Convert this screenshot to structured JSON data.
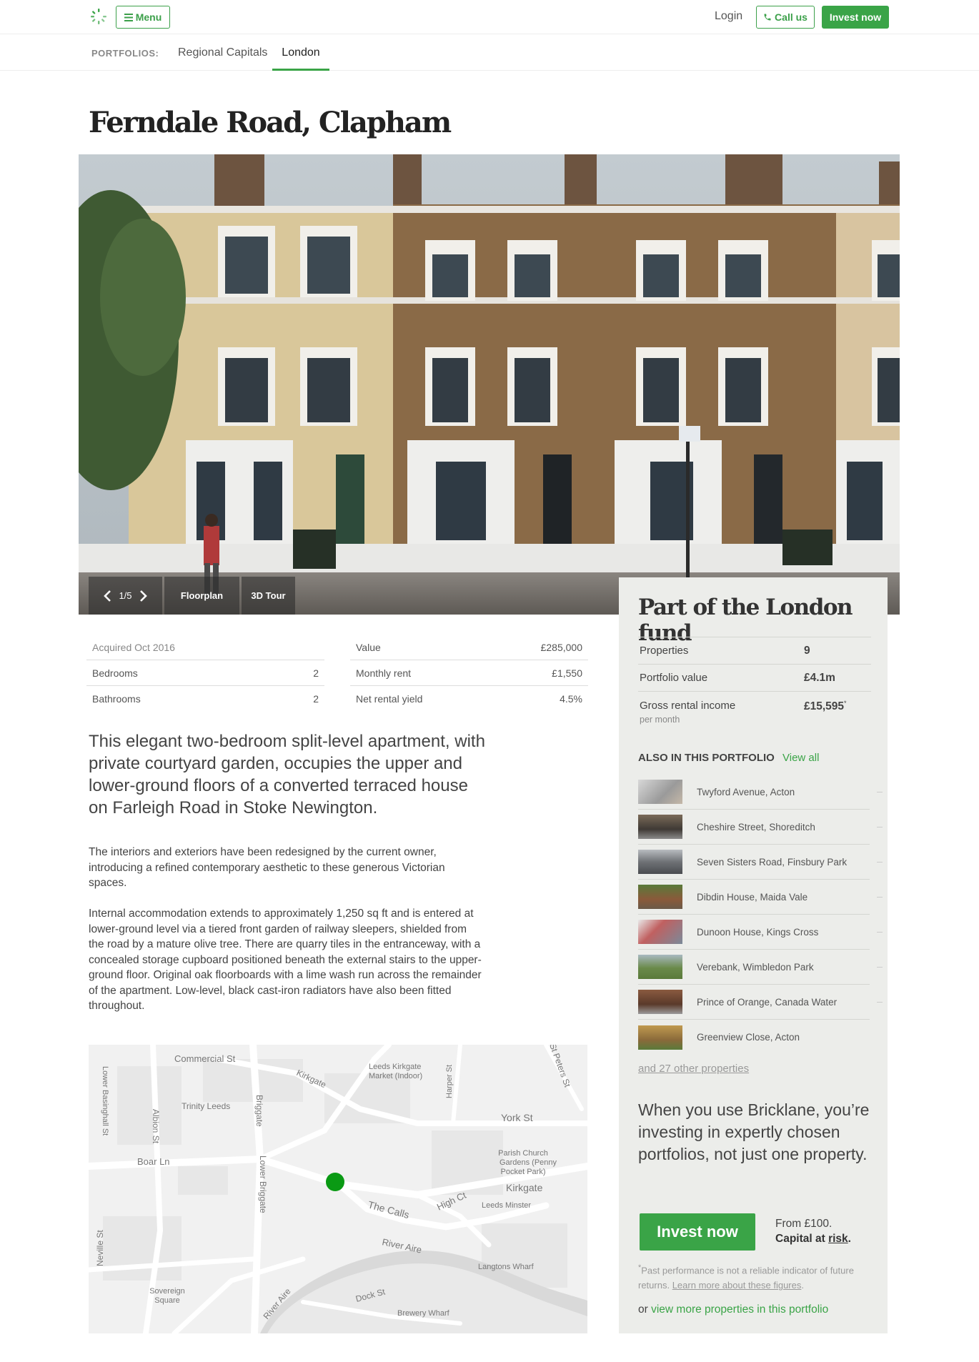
{
  "header": {
    "menu_label": "Menu",
    "login_label": "Login",
    "call_label": "Call us",
    "invest_label": "Invest now"
  },
  "subnav": {
    "label": "PORTFOLIOS:",
    "tabs": [
      "Regional Capitals",
      "London"
    ],
    "active_tab": "London"
  },
  "property": {
    "title": "Ferndale Road, Clapham",
    "gallery": {
      "counter": "1/5",
      "floorplan_label": "Floorplan",
      "tour_label": "3D Tour"
    },
    "acquired": "Acquired Oct 2016",
    "bedrooms_label": "Bedrooms",
    "bedrooms": "2",
    "bathrooms_label": "Bathrooms",
    "bathrooms": "2",
    "value_label": "Value",
    "value": "£285,000",
    "rent_label": "Monthly rent",
    "rent": "£1,550",
    "yield_label": "Net rental yield",
    "yield": "4.5%",
    "lead": "This elegant two-bedroom split-level apartment, with private courtyard garden, occupies the upper and lower-ground floors of a converted terraced house on Farleigh Road in Stoke Newington.",
    "para1": "The interiors and exteriors have been redesigned by the current owner, introducing a refined contemporary aesthetic to these generous Victorian spaces.",
    "para2": "Internal accommodation extends to approximately 1,250 sq ft and is entered at lower-ground level via a tiered front garden of railway sleepers, shielded from the road by a mature olive tree. There are quarry tiles in the entranceway, with a concealed storage cupboard positioned beneath the external stairs to the upper-ground floor. Original oak floorboards with a lime wash run across the remainder of the apartment. Low-level, black cast-iron radiators have also been fitted throughout."
  },
  "map": {
    "labels": {
      "commercial_st": "Commercial St",
      "kirkgate_top": "Kirkgate",
      "leeds_kirkgate_1": "Leeds Kirkgate",
      "leeds_kirkgate_2": "Market (Indoor)",
      "harper_st": "Harper St",
      "st_peters_st": "St Peters St",
      "lower_basinghall_st": "Lower Basinghall St",
      "trinity_leeds": "Trinity Leeds",
      "albion_st": "Albion St",
      "briggate": "Briggate",
      "york_st": "York St",
      "boar_ln": "Boar Ln",
      "lower_briggate": "Lower Briggate",
      "parish_church_1": "Parish Church",
      "parish_church_2": "Gardens (Penny",
      "parish_church_3": "Pocket Park)",
      "kirkgate_right": "Kirkgate",
      "high_ct": "High Ct",
      "leeds_minster": "Leeds Minster",
      "the_calls": "The Calls",
      "river_aire_mid": "River Aire",
      "langtons_wharf": "Langtons Wharf",
      "neville_st": "Neville St",
      "river_aire_bottom": "River Aire",
      "sovereign_1": "Sovereign",
      "sovereign_2": "Square",
      "dock_st": "Dock St",
      "brewery_wharf": "Brewery Wharf"
    },
    "marker_color": "#0a9a14"
  },
  "fund": {
    "title": "Part of the London fund",
    "properties_label": "Properties",
    "properties": "9",
    "value_label": "Portfolio value",
    "value": "£4.1m",
    "income_label": "Gross rental income",
    "income": "£15,595",
    "income_note": "*",
    "income_sub": "per month",
    "also_label": "ALSO IN THIS PORTFOLIO",
    "view_all": "View all",
    "items": [
      "Twyford Avenue, Acton",
      "Cheshire Street, Shoreditch",
      "Seven Sisters Road, Finsbury Park",
      "Dibdin House, Maida Vale",
      "Dunoon House, Kings Cross",
      "Verebank, Wimbledon Park",
      "Prince of Orange, Canada Water",
      "Greenview Close, Acton"
    ],
    "others": "and 27 other properties",
    "pitch": "When you use Bricklane, you’re investing in expertly chosen portfolios, not just one property.",
    "invest_label": "Invest now",
    "from": "From £100.",
    "capital_prefix": "Capital at ",
    "capital_link": "risk",
    "capital_suffix": ".",
    "disclaimer": "Past performance is not a reliable indicator of future returns.",
    "disclaimer_mark": "*",
    "learn_more": "Learn more about these figures",
    "learn_suffix": ".",
    "or_prefix": "or ",
    "or_link": "view more properties in this portfolio"
  },
  "colors": {
    "brand_green": "#3aa447",
    "sidebar_bg": "#ecedea"
  },
  "icons": [
    "logo-icon",
    "menu-icon",
    "phone-icon",
    "chevron-left-icon",
    "chevron-right-icon",
    "map-marker-icon"
  ]
}
